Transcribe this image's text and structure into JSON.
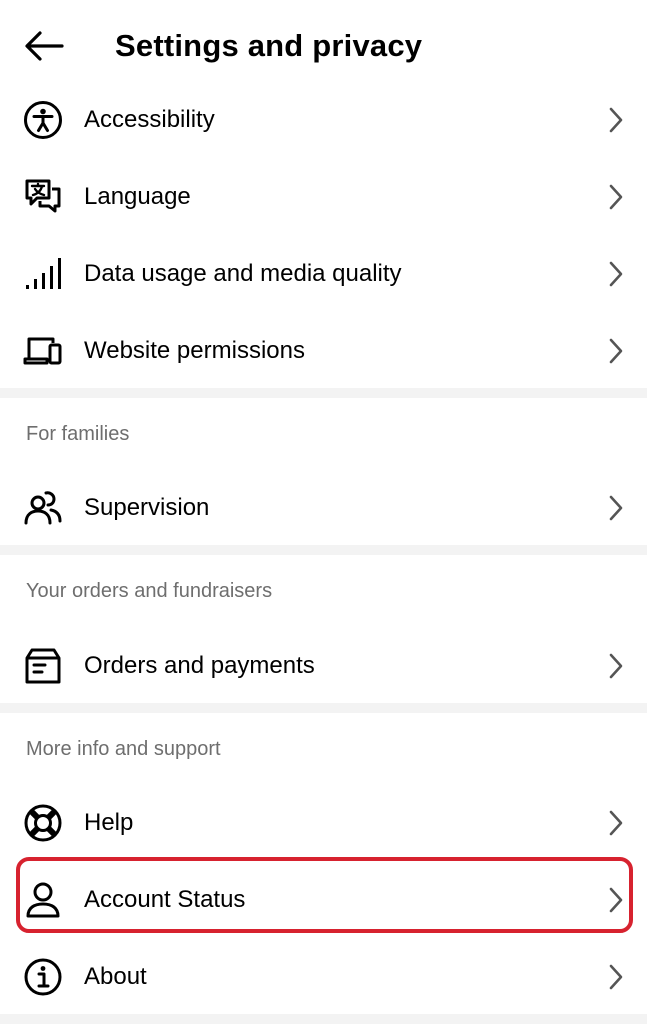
{
  "header": {
    "title": "Settings and privacy",
    "back_icon": "arrow-left-icon"
  },
  "rows": {
    "accessibility": {
      "label": "Accessibility",
      "icon": "accessibility-icon"
    },
    "language": {
      "label": "Language",
      "icon": "translate-icon"
    },
    "data_usage": {
      "label": "Data usage and media quality",
      "icon": "signal-bars-icon"
    },
    "website_permissions": {
      "label": "Website permissions",
      "icon": "devices-icon"
    },
    "supervision": {
      "label": "Supervision",
      "icon": "people-icon"
    },
    "orders_payments": {
      "label": "Orders and payments",
      "icon": "orders-box-icon"
    },
    "help": {
      "label": "Help",
      "icon": "lifebuoy-icon"
    },
    "account_status": {
      "label": "Account Status",
      "icon": "user-icon"
    },
    "about": {
      "label": "About",
      "icon": "info-icon"
    }
  },
  "sections": {
    "for_families": "For families",
    "orders_fundraisers": "Your orders and fundraisers",
    "more_info_support": "More info and support"
  },
  "colors": {
    "highlight": "#d7222f",
    "section_header": "#6e6e6e",
    "divider": "#f3f3f3"
  }
}
